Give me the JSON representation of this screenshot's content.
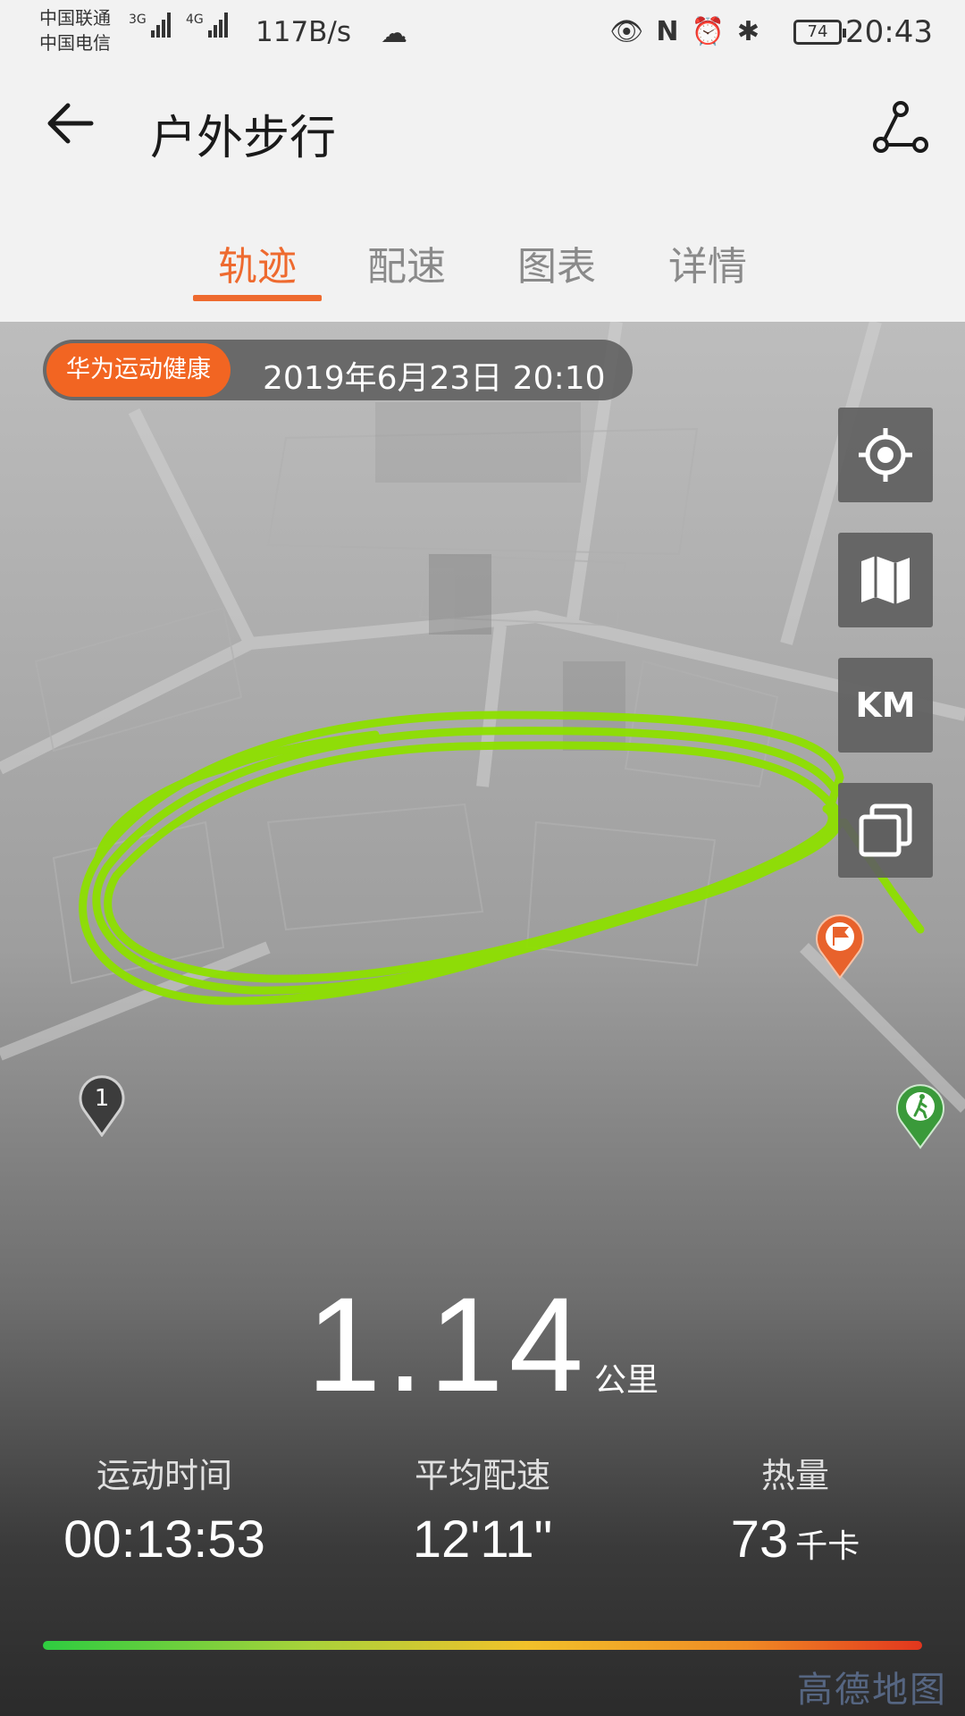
{
  "status_bar": {
    "carrier1": "中国联通",
    "carrier2": "中国电信",
    "net1": "3G",
    "net2": "4G",
    "speed": "117B/s",
    "battery": "74",
    "time": "20:43"
  },
  "app_bar": {
    "title": "户外步行"
  },
  "tabs": [
    {
      "label": "轨迹",
      "active": true
    },
    {
      "label": "配速",
      "active": false
    },
    {
      "label": "图表",
      "active": false
    },
    {
      "label": "详情",
      "active": false
    }
  ],
  "map": {
    "brand_badge": "华为运动健康",
    "datetime": "2019年6月23日 20:10",
    "km_button": "KM",
    "lap_marker": "1",
    "track_color": "#8ee000",
    "end_flag_color": "#e8622c",
    "start_marker_color": "#3a9a3a",
    "watermark": "高德地图"
  },
  "summary": {
    "distance": "1.14",
    "distance_unit": "公里",
    "stats": [
      {
        "label": "运动时间",
        "value": "00:13:53",
        "unit": ""
      },
      {
        "label": "平均配速",
        "value": "12'11\"",
        "unit": ""
      },
      {
        "label": "热量",
        "value": "73",
        "unit": "千卡"
      }
    ]
  },
  "icons": {
    "back": "back-arrow-icon",
    "route": "route-share-icon",
    "locate": "locate-icon",
    "map_type": "map-icon",
    "layers": "layers-icon"
  }
}
